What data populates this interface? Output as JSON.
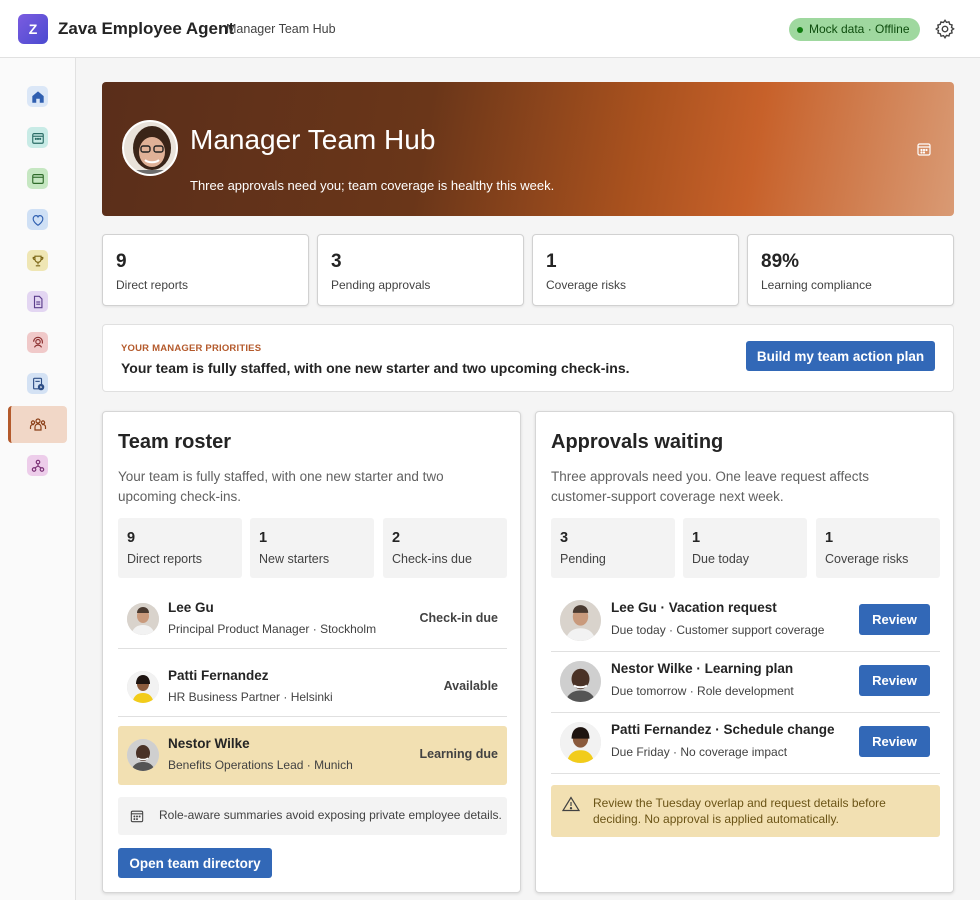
{
  "app": {
    "logo_letter": "Z",
    "title": "Zava Employee Agent",
    "subtitle": "Manager Team Hub",
    "status": "Mock data · Offline"
  },
  "sidebar": {
    "items": [
      {
        "icon": "home-icon",
        "color": "#dbe7f7"
      },
      {
        "icon": "calendar-icon",
        "color": "#c8ebe6"
      },
      {
        "icon": "wallet-icon",
        "color": "#c6e7c2"
      },
      {
        "icon": "heart-icon",
        "color": "#cfe0f5"
      },
      {
        "icon": "trophy-icon",
        "color": "#efe6b4"
      },
      {
        "icon": "document-icon",
        "color": "#e3d6f2"
      },
      {
        "icon": "person-support-icon",
        "color": "#f0c9c9"
      },
      {
        "icon": "form-play-icon",
        "color": "#d4e2f4"
      },
      {
        "icon": "team-icon",
        "color": "#f1d7c7",
        "active": true
      },
      {
        "icon": "org-chart-icon",
        "color": "#edcdea"
      }
    ]
  },
  "hero": {
    "title": "Manager Team Hub",
    "subtitle": "Three approvals need you; team coverage is healthy this week."
  },
  "kpis": [
    {
      "value": "9",
      "label": "Direct reports"
    },
    {
      "value": "3",
      "label": "Pending approvals"
    },
    {
      "value": "1",
      "label": "Coverage risks"
    },
    {
      "value": "89%",
      "label": "Learning compliance"
    }
  ],
  "priorities": {
    "eyebrow": "YOUR MANAGER PRIORITIES",
    "text": "Your team is fully staffed, with one new starter and two upcoming check-ins.",
    "button": "Build my team action plan"
  },
  "roster": {
    "title": "Team roster",
    "description": "Your team is fully staffed, with one new starter and two upcoming check-ins.",
    "stats": [
      {
        "value": "9",
        "label": "Direct reports"
      },
      {
        "value": "1",
        "label": "New starters"
      },
      {
        "value": "2",
        "label": "Check-ins due"
      }
    ],
    "members": [
      {
        "name": "Lee Gu",
        "role": "Principal Product Manager · Stockholm",
        "status": "Check-in due"
      },
      {
        "name": "Patti Fernandez",
        "role": "HR Business Partner · Helsinki",
        "status": "Available"
      },
      {
        "name": "Nestor Wilke",
        "role": "Benefits Operations Lead · Munich",
        "status": "Learning due"
      }
    ],
    "note": "Role-aware summaries avoid exposing private employee details.",
    "button": "Open team directory"
  },
  "approvals": {
    "title": "Approvals waiting",
    "description": "Three approvals need you. One leave request affects customer-support coverage next week.",
    "stats": [
      {
        "value": "3",
        "label": "Pending"
      },
      {
        "value": "1",
        "label": "Due today"
      },
      {
        "value": "1",
        "label": "Coverage risks"
      }
    ],
    "items": [
      {
        "title": "Lee Gu · Vacation request",
        "meta": "Due today · Customer support coverage",
        "button": "Review"
      },
      {
        "title": "Nestor Wilke · Learning plan",
        "meta": "Due tomorrow · Role development",
        "button": "Review"
      },
      {
        "title": "Patti Fernandez · Schedule change",
        "meta": "Due Friday · No coverage impact",
        "button": "Review"
      }
    ],
    "warning": "Review the Tuesday overlap and request details before deciding. No approval is applied automatically."
  }
}
